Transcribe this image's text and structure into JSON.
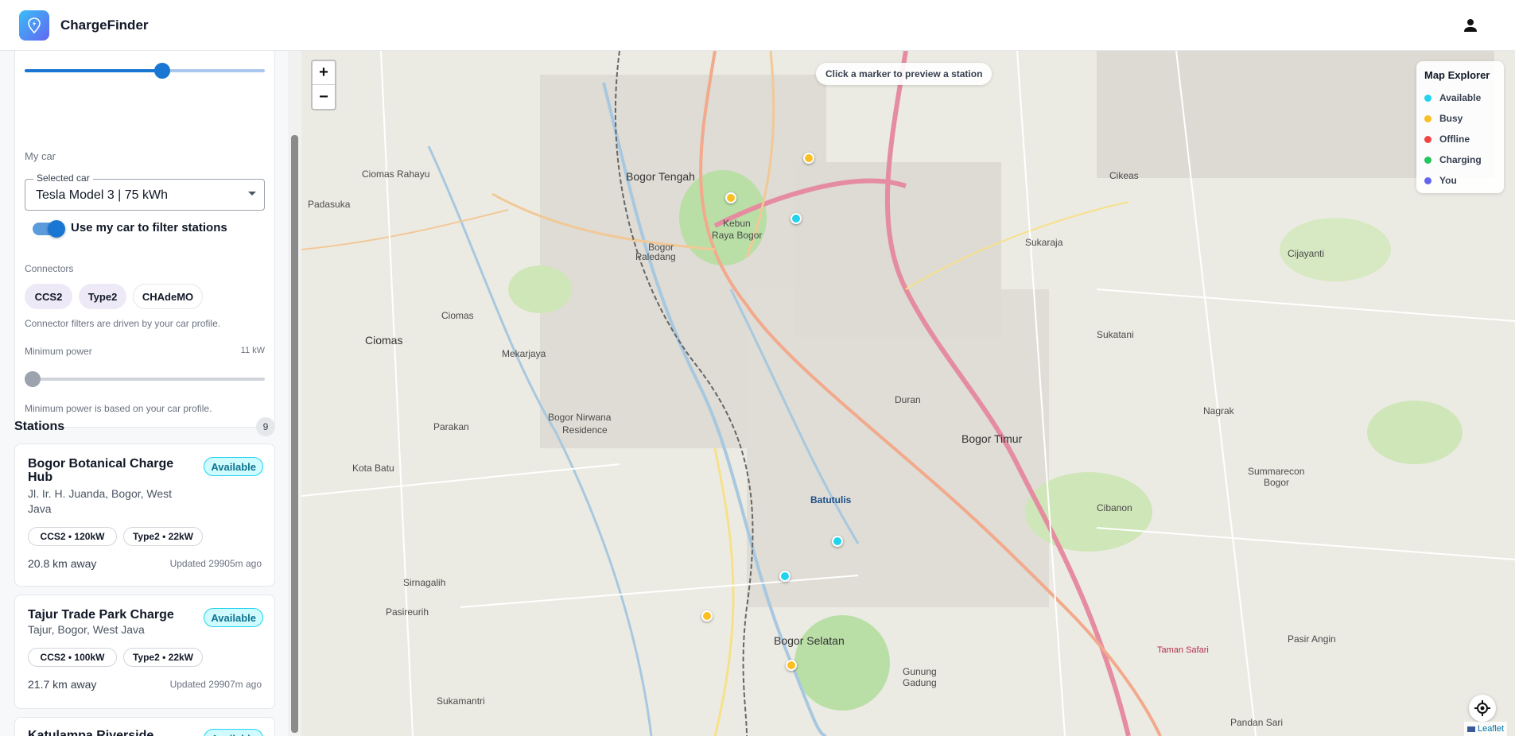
{
  "app": {
    "title": "ChargeFinder"
  },
  "filters": {
    "my_car_label": "My car",
    "selected_car_label": "Selected car",
    "selected_car_value": "Tesla Model 3 | 75 kWh",
    "use_car_label": "Use my car to filter stations",
    "use_car_enabled": true,
    "connectors_label": "Connectors",
    "connectors": [
      {
        "label": "CCS2",
        "selected": true
      },
      {
        "label": "Type2",
        "selected": true
      },
      {
        "label": "CHAdeMO",
        "selected": false
      }
    ],
    "connector_hint": "Connector filters are driven by your car profile.",
    "min_power_label": "Minimum power",
    "min_power_value": "11 kW",
    "min_power_hint": "Minimum power is based on your car profile."
  },
  "stations": {
    "title": "Stations",
    "count": "9",
    "items": [
      {
        "name_line1": "Bogor Botanical Charge",
        "name_line2": "Hub",
        "address_line1": "Jl. Ir. H. Juanda, Bogor, West",
        "address_line2": "Java",
        "status": "Available",
        "chips": [
          "CCS2 • 120kW",
          "Type2 • 22kW"
        ],
        "distance": "20.8 km away",
        "updated": "Updated 29905m ago"
      },
      {
        "name_line1": "Tajur Trade Park Charge",
        "address_line1": "Tajur, Bogor, West Java",
        "status": "Available",
        "chips": [
          "CCS2 • 100kW",
          "Type2 • 22kW"
        ],
        "distance": "21.7 km away",
        "updated": "Updated 29907m ago"
      },
      {
        "name_line1": "Katulampa Riverside",
        "status": "Available"
      }
    ]
  },
  "map": {
    "zoom_in": "+",
    "zoom_out": "−",
    "tip": "Click a marker to preview a station",
    "legend": {
      "title": "Map Explorer",
      "items": [
        {
          "label": "Available",
          "color": "#22d3ee"
        },
        {
          "label": "Busy",
          "color": "#fbbf24"
        },
        {
          "label": "Offline",
          "color": "#ef4444"
        },
        {
          "label": "Charging",
          "color": "#22c55e"
        },
        {
          "label": "You",
          "color": "#6366f1"
        }
      ]
    },
    "attribution": "Leaflet",
    "places": {
      "bogor_tengah": "Bogor Tengah",
      "kebun": "Kebun",
      "raya_bogor": "Raya Bogor",
      "ciomas": "Ciomas",
      "ciomas_rahayu": "Ciomas Rahayu",
      "padasuka": "Padasuka",
      "ciomas2": "Ciomas",
      "mekarjaya": "Mekarjaya",
      "parakan": "Parakan",
      "kota_batu": "Kota Batu",
      "sirnagalih": "Sirnagalih",
      "pasireurih": "Pasireurih",
      "sukamantri": "Sukamantri",
      "bogor_nirwana": "Bogor Nirwana",
      "residence": "Residence",
      "batutulis": "Batutulis",
      "bogor_selatan": "Bogor Selatan",
      "gunung": "Gunung",
      "gadung": "Gadung",
      "bogor_timur": "Bogor Timur",
      "cikeas": "Cikeas",
      "sukaraja": "Sukaraja",
      "sukatani": "Sukatani",
      "cijayanti": "Cijayanti",
      "nagrak": "Nagrak",
      "summarecon": "Summarecon",
      "bogor": "Bogor",
      "cibanon": "Cibanon",
      "pasir_angin": "Pasir Angin",
      "pandan_sari": "Pandan Sari",
      "taman_safari": "Taman Safari",
      "bogor_paledang": "Bogor",
      "paledang": "Paledang",
      "duran": "Duran"
    }
  }
}
